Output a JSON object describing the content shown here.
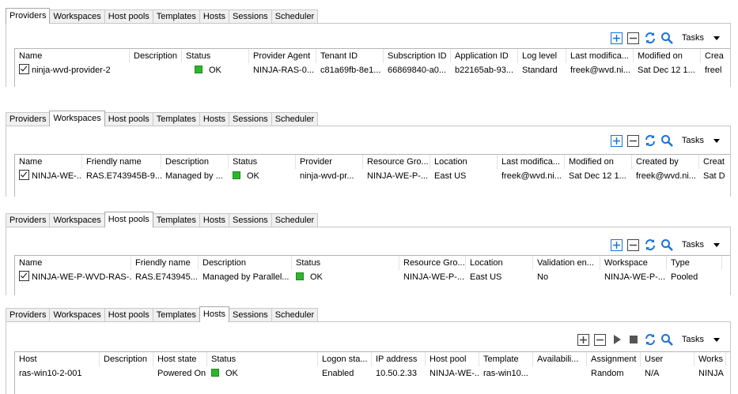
{
  "tabs": [
    "Providers",
    "Workspaces",
    "Host pools",
    "Templates",
    "Hosts",
    "Sessions",
    "Scheduler"
  ],
  "tasks_label": "Tasks",
  "colors": {
    "accent": "#1a72d8",
    "status_ok": "#2db52d"
  },
  "providers": {
    "active_tab": "Providers",
    "columns": [
      "Name",
      "Description",
      "Status",
      "Provider Agent",
      "Tenant ID",
      "Subscription ID",
      "Application ID",
      "Log level",
      "Last modifica...",
      "Modified on",
      "Crea"
    ],
    "row": {
      "name": "ninja-wvd-provider-2",
      "description": "",
      "status": "OK",
      "provider_agent": "NINJA-RAS-0...",
      "tenant_id": "c81a69fb-8e1...",
      "subscription_id": "66869840-a0...",
      "application_id": "b22165ab-93...",
      "log_level": "Standard",
      "last_modified_by": "freek@wvd.ni...",
      "modified_on": "Sat Dec 12 1...",
      "created": "freel"
    }
  },
  "workspaces": {
    "active_tab": "Workspaces",
    "columns": [
      "Name",
      "Friendly name",
      "Description",
      "Status",
      "Provider",
      "Resource Gro...",
      "Location",
      "Last modifica...",
      "Modified on",
      "Created by",
      "Creat"
    ],
    "row": {
      "name": "NINJA-WE-...",
      "friendly_name": "RAS.E743945B-9...",
      "description": "Managed by ...",
      "status": "OK",
      "provider": "ninja-wvd-pr...",
      "resource_group": "NINJA-WE-P-...",
      "location": "East US",
      "last_modified_by": "freek@wvd.ni...",
      "modified_on": "Sat Dec 12 1...",
      "created_by": "freek@wvd.ni...",
      "created": "Sat D"
    }
  },
  "hostpools": {
    "active_tab": "Host pools",
    "columns": [
      "Name",
      "Friendly name",
      "Description",
      "Status",
      "Resource Gro...",
      "Location",
      "Validation en...",
      "Workspace",
      "Type"
    ],
    "row": {
      "name": "NINJA-WE-P-WVD-RAS-...",
      "friendly_name": "RAS.E743945...",
      "description": "Managed by Parallel...",
      "status": "OK",
      "resource_group": "NINJA-WE-P-...",
      "location": "East US",
      "validation": "No",
      "workspace": "NINJA-WE-P-...",
      "type": "Pooled"
    }
  },
  "hosts": {
    "active_tab": "Hosts",
    "columns": [
      "Host",
      "Description",
      "Host state",
      "Status",
      "Logon sta...",
      "IP address",
      "Host pool",
      "Template",
      "Availabili...",
      "Assignment",
      "User",
      "Works"
    ],
    "row": {
      "host": "ras-win10-2-001",
      "description": "",
      "host_state": "Powered On",
      "status": "OK",
      "logon_state": "Enabled",
      "ip_address": "10.50.2.33",
      "host_pool": "NINJA-WE-...",
      "template": "ras-win10...",
      "availability": "",
      "assignment": "Random",
      "user": "N/A",
      "workspace": "NINJA"
    }
  }
}
